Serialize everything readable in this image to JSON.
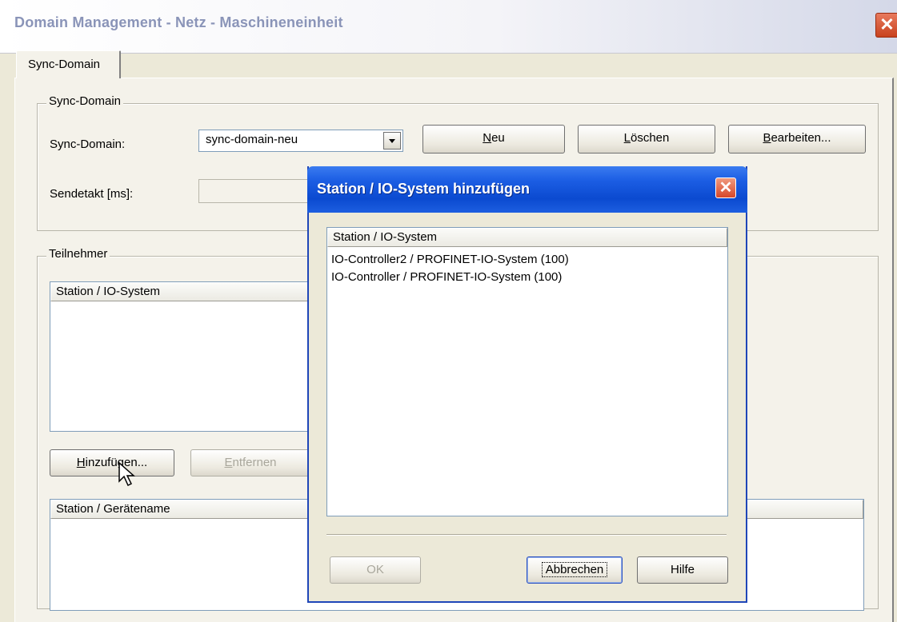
{
  "window": {
    "title": "Domain Management - Netz - Maschineneinheit",
    "close_glyph": "✕"
  },
  "tabs": [
    {
      "label": "Sync-Domain"
    }
  ],
  "sync_group": {
    "legend": "Sync-Domain",
    "domain_label": "Sync-Domain:",
    "domain_value": "sync-domain-neu",
    "send_label": "Sendetakt [ms]:",
    "send_value": "",
    "buttons": {
      "new": {
        "mnemonic": "N",
        "rest": "eu"
      },
      "delete": {
        "mnemonic": "L",
        "rest": "öschen"
      },
      "edit": {
        "mnemonic": "B",
        "rest": "earbeiten..."
      }
    }
  },
  "participants_group": {
    "legend": "Teilnehmer",
    "station_header": "Station / IO-System",
    "add_button": {
      "mnemonic": "H",
      "rest": "inzufügen..."
    },
    "remove_button": {
      "mnemonic": "E",
      "rest": "ntfernen"
    },
    "device_header": "Station / Gerätename"
  },
  "dialog": {
    "title": "Station / IO-System hinzufügen",
    "close_glyph": "✕",
    "list_header": "Station / IO-System",
    "items": [
      "IO-Controller2 / PROFINET-IO-System (100)",
      "IO-Controller / PROFINET-IO-System (100)"
    ],
    "ok_label": "OK",
    "cancel_label": "Abbrechen",
    "help_label": "Hilfe"
  },
  "icons": {
    "dropdown": "chevron-down-icon",
    "cursor": "mouse-pointer-icon"
  },
  "colors": {
    "title_bar_blue": "#0b4ad0",
    "close_red": "#d6472a",
    "window_bg": "#ece9d8"
  }
}
